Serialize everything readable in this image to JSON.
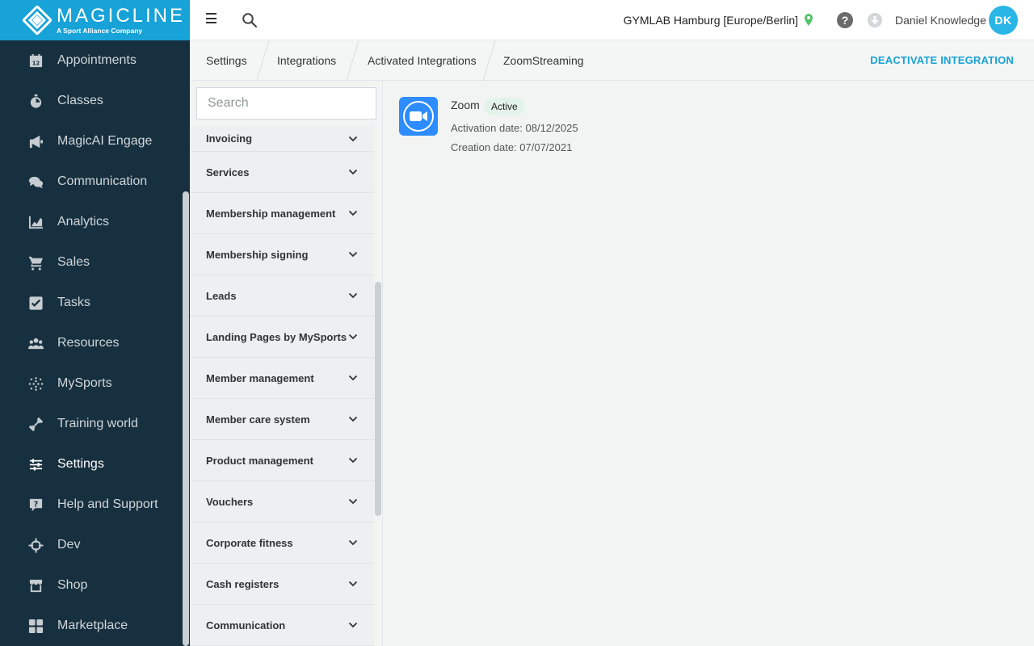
{
  "brand": {
    "name": "MAGICLINE",
    "tagline": "A Sport Alliance Company",
    "color": "#17a2d8"
  },
  "sidebar": {
    "items": [
      {
        "label": "Appointments",
        "icon": "calendar-icon"
      },
      {
        "label": "Classes",
        "icon": "stopwatch-icon"
      },
      {
        "label": "MagicAI Engage",
        "icon": "megaphone-icon"
      },
      {
        "label": "Communication",
        "icon": "chat-bubbles-icon"
      },
      {
        "label": "Analytics",
        "icon": "area-chart-icon"
      },
      {
        "label": "Sales",
        "icon": "cart-icon"
      },
      {
        "label": "Tasks",
        "icon": "checkbox-icon"
      },
      {
        "label": "Resources",
        "icon": "people-icon"
      },
      {
        "label": "MySports",
        "icon": "dots-grid-icon"
      },
      {
        "label": "Training world",
        "icon": "dumbbell-icon"
      },
      {
        "label": "Settings",
        "icon": "sliders-icon",
        "active": true
      },
      {
        "label": "Help and Support",
        "icon": "help-bubble-icon"
      },
      {
        "label": "Dev",
        "icon": "crosshair-icon"
      },
      {
        "label": "Shop",
        "icon": "store-icon"
      },
      {
        "label": "Marketplace",
        "icon": "apps-grid-icon"
      }
    ]
  },
  "topbar": {
    "studio": "GYMLAB Hamburg [Europe/Berlin]",
    "user_name": "Daniel Knowledge",
    "avatar_initials": "DK",
    "help_glyph": "?"
  },
  "breadcrumb": {
    "items": [
      "Settings",
      "Integrations",
      "Activated Integrations",
      "ZoomStreaming"
    ],
    "action_label": "DEACTIVATE INTEGRATION"
  },
  "panel": {
    "search_placeholder": "Search",
    "items": [
      "Invoicing",
      "Services",
      "Membership management",
      "Membership signing",
      "Leads",
      "Landing Pages by MySports",
      "Member management",
      "Member care system",
      "Product management",
      "Vouchers",
      "Corporate fitness",
      "Cash registers",
      "Communication"
    ]
  },
  "integration": {
    "name": "Zoom",
    "status": "Active",
    "activation_date": "Activation date: 08/12/2025",
    "creation_date": "Creation date: 07/07/2021",
    "logo_color": "#2d8cff"
  }
}
